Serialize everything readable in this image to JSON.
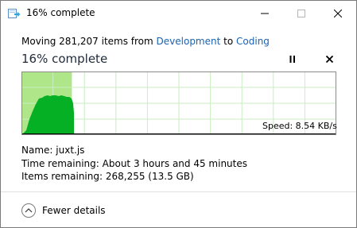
{
  "window": {
    "title": "16% complete"
  },
  "operation": {
    "prefix": "Moving 281,207 items from ",
    "source": "Development",
    "connector": " to ",
    "destination": "Coding"
  },
  "status": {
    "heading": "16% complete",
    "progress_fraction": 0.16
  },
  "graph": {
    "speed_text": "Speed: 8.54 KB/s",
    "fill_color": "#b0e68a",
    "curve_color": "#06b025",
    "grid_color": "#c8eec0"
  },
  "details": {
    "name_label": "Name:",
    "name_value": "juxt.js",
    "time_label": "Time remaining:",
    "time_value": "About 3 hours and 45 minutes",
    "items_label": "Items remaining:",
    "items_value": "268,255 (13.5 GB)"
  },
  "footer": {
    "toggle_label": "Fewer details"
  },
  "colors": {
    "link": "#1b62b5",
    "heading": "#1e2a3a"
  }
}
